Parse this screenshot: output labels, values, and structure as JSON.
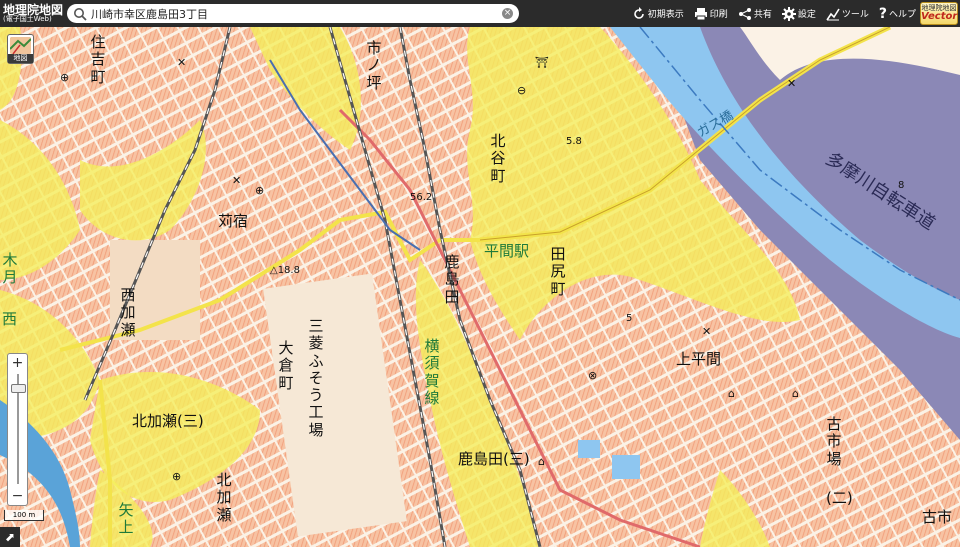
{
  "header": {
    "logo_title": "地理院地図",
    "logo_subtitle": "(電子国土Web)"
  },
  "search": {
    "value": "川崎市幸区鹿島田3丁目",
    "placeholder": ""
  },
  "toolbar": {
    "reset_label": "初期表示",
    "print_label": "印刷",
    "share_label": "共有",
    "settings_label": "設定",
    "tools_label": "ツール",
    "help_label": "ヘルプ"
  },
  "vector_button": {
    "line1": "地理院地図",
    "line2": "Vector"
  },
  "basemap_button": {
    "label": "地図"
  },
  "zoom": {
    "in": "+",
    "out": "−",
    "level_fraction": 0.1
  },
  "scale": {
    "label": "100 m"
  },
  "colors": {
    "river": "#8ec6f0",
    "embankment": "#8b88b6",
    "flood_yellow": "#f5ee5a",
    "residential": "#f6b890",
    "road_main": "#f3e34b",
    "rail": "#555555"
  },
  "labels": {
    "sumiyoshi": "住吉町",
    "ichinotsubo": "市ノ坪",
    "kitaya": "北谷町",
    "tamagawa": "多摩川自転車道",
    "kariyado": "苅宿",
    "elev1": "△18.8",
    "elev2": "56.2",
    "elev3": "5.8",
    "elev4": "8",
    "elev5": "5",
    "hirama_sta": "平間駅",
    "tajiri": "田尻町",
    "kashimada_v": "鹿島田",
    "nishikase": "西加瀬",
    "okura": "大倉町",
    "mitsubishi": "三菱ふそう工場",
    "yokosuka": "横須賀線",
    "kamihirama": "上平間",
    "furuichiba": "古市場",
    "furuichiba2": "(二)",
    "kitakase": "北加瀬(三)",
    "kitakase2": "北加瀬",
    "kashimada3": "鹿島田(三)",
    "furuichi": "古市",
    "gasu": "ガス橋",
    "ya": "矢上",
    "tsuki": "木月",
    "nishi": "西"
  }
}
